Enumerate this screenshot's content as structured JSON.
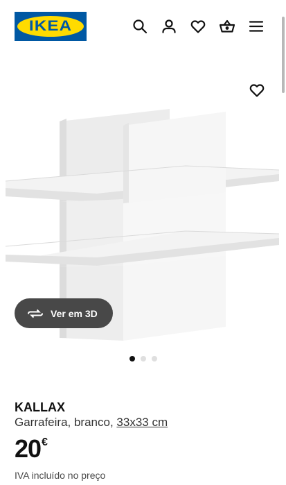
{
  "header": {
    "logo_text": "IKEA",
    "icons": [
      "search-icon",
      "account-icon",
      "heart-icon",
      "basket-icon",
      "menu-icon"
    ]
  },
  "gallery": {
    "view_3d_label": "Ver em 3D",
    "image_count": 3,
    "active_image_index": 0
  },
  "product": {
    "name": "KALLAX",
    "description_prefix": "Garrafeira, branco, ",
    "dimensions": "33x33 cm",
    "price_integer": "20",
    "price_currency": "€",
    "vat_note": "IVA incluído no preço"
  },
  "colors": {
    "brand_blue": "#0058a3",
    "brand_yellow": "#ffdb00",
    "button_dark": "#484848"
  }
}
